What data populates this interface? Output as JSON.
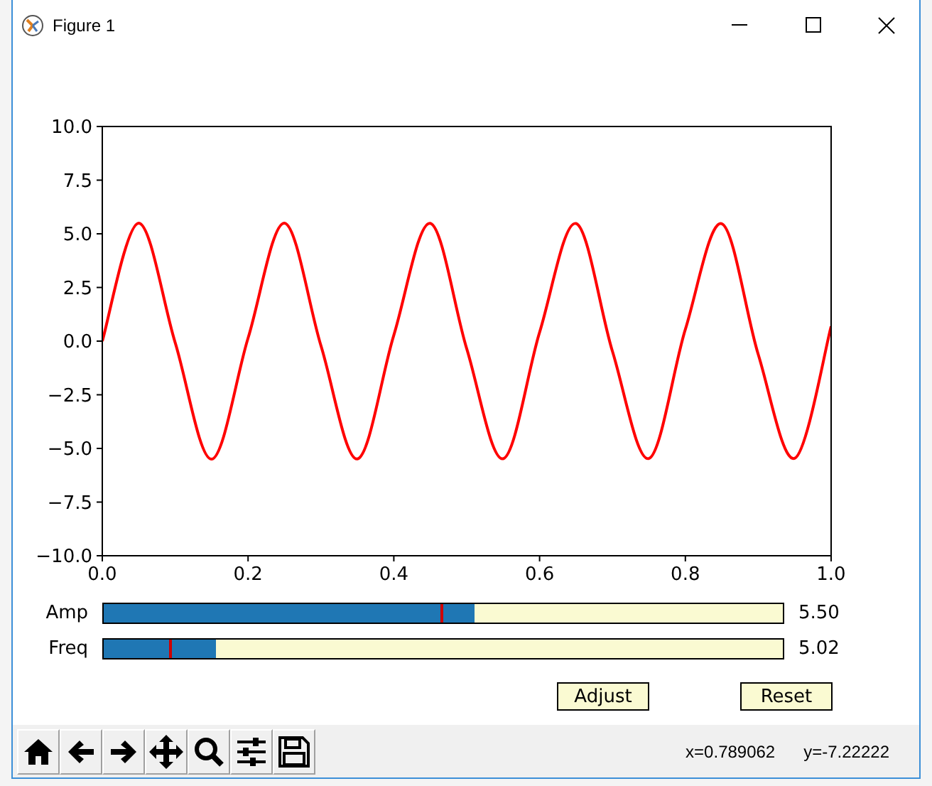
{
  "window": {
    "title": "Figure 1"
  },
  "chart_data": {
    "type": "line",
    "x": [
      0,
      0.05,
      0.1,
      0.15,
      0.2,
      0.25,
      0.3,
      0.35,
      0.4,
      0.45,
      0.5,
      0.55,
      0.6,
      0.65,
      0.7,
      0.75,
      0.8,
      0.85,
      0.9,
      0.95,
      1.0
    ],
    "series": [
      {
        "color": "#ff0000",
        "values": [
          0,
          5.5,
          -0.07,
          -5.5,
          0.14,
          5.5,
          -0.21,
          -5.49,
          0.28,
          5.49,
          -0.35,
          -5.48,
          0.41,
          5.48,
          -0.48,
          -5.47,
          0.55,
          5.47,
          -0.62,
          -5.46,
          0.69
        ]
      }
    ],
    "xlim": [
      0,
      1
    ],
    "ylim": [
      -10,
      10
    ],
    "xticks": [
      {
        "value": 0,
        "label": "0.0"
      },
      {
        "value": 0.2,
        "label": "0.2"
      },
      {
        "value": 0.4,
        "label": "0.4"
      },
      {
        "value": 0.6,
        "label": "0.6"
      },
      {
        "value": 0.8,
        "label": "0.8"
      },
      {
        "value": 1,
        "label": "1.0"
      }
    ],
    "yticks": [
      {
        "value": -10,
        "label": "−10.0"
      },
      {
        "value": -7.5,
        "label": "−7.5"
      },
      {
        "value": -5,
        "label": "−5.0"
      },
      {
        "value": -2.5,
        "label": "−2.5"
      },
      {
        "value": 0,
        "label": "0.0"
      },
      {
        "value": 2.5,
        "label": "2.5"
      },
      {
        "value": 5,
        "label": "5.0"
      },
      {
        "value": 7.5,
        "label": "7.5"
      },
      {
        "value": 10,
        "label": "10.0"
      }
    ]
  },
  "sliders": [
    {
      "label": "Amp",
      "level": 0.546,
      "initial_marker": {
        "level": 0.495
      },
      "reading": "5.50"
    },
    {
      "label": "Freq",
      "level": 0.165,
      "initial_marker": {
        "level": 0.097
      },
      "reading": "5.02"
    }
  ],
  "buttons": [
    {
      "label": "Adjust"
    },
    {
      "label": "Reset"
    }
  ],
  "toolbar": {
    "tools": [
      {
        "kind": "home"
      },
      {
        "kind": "back"
      },
      {
        "kind": "forward"
      },
      {
        "kind": "pan"
      },
      {
        "kind": "zoom"
      },
      {
        "kind": "configure"
      },
      {
        "kind": "save"
      }
    ],
    "coordinates": [
      "x=0.789062",
      "y=-7.22222"
    ]
  }
}
